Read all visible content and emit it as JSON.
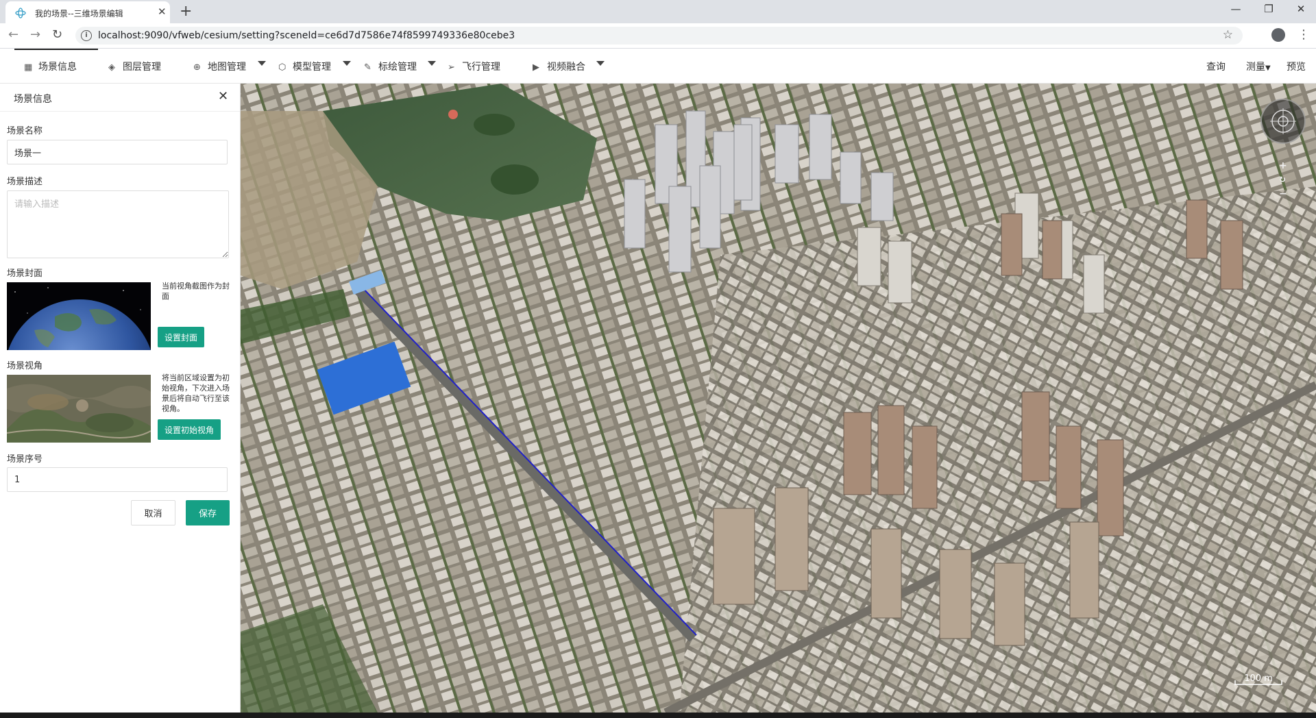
{
  "browser": {
    "tab_title": "我的场景--三维场景编辑",
    "url": "localhost:9090/vfweb/cesium/setting?sceneId=ce6d7d7586e74f8599749336e80cebe3",
    "new_tab": "+",
    "close_tab": "✕",
    "minimize": "—",
    "maximize": "❐",
    "close_window": "✕"
  },
  "toolbar": {
    "items": [
      {
        "label": "场景信息",
        "icon": "scene-info-icon"
      },
      {
        "label": "图层管理",
        "icon": "layers-icon"
      },
      {
        "label": "地图管理",
        "icon": "globe-icon"
      },
      {
        "label": "模型管理",
        "icon": "cube-icon"
      },
      {
        "label": "标绘管理",
        "icon": "pen-icon"
      },
      {
        "label": "飞行管理",
        "icon": "paper-plane-icon"
      },
      {
        "label": "视频融合",
        "icon": "video-icon"
      }
    ],
    "right": [
      {
        "label": "查询"
      },
      {
        "label": "测量"
      },
      {
        "label": "预览"
      }
    ]
  },
  "panel": {
    "title": "场景信息",
    "name_label": "场景名称",
    "name_value": "场景一",
    "desc_label": "场景描述",
    "desc_placeholder": "请输入描述",
    "cover_label": "场景封面",
    "cover_hint": "当前视角截图作为封面",
    "cover_button": "设置封面",
    "view_label": "场景视角",
    "view_hint": "将当前区域设置为初始视角，下次进入场景后将自动飞行至该视角。",
    "view_button": "设置初始视角",
    "order_label": "场景序号",
    "order_value": "1",
    "cancel_button": "取消",
    "save_button": "保存"
  },
  "map": {
    "scale": "100 m",
    "zoom_in": "+",
    "reset": "↻",
    "zoom_out": "−"
  },
  "colors": {
    "accent": "#16a085"
  }
}
